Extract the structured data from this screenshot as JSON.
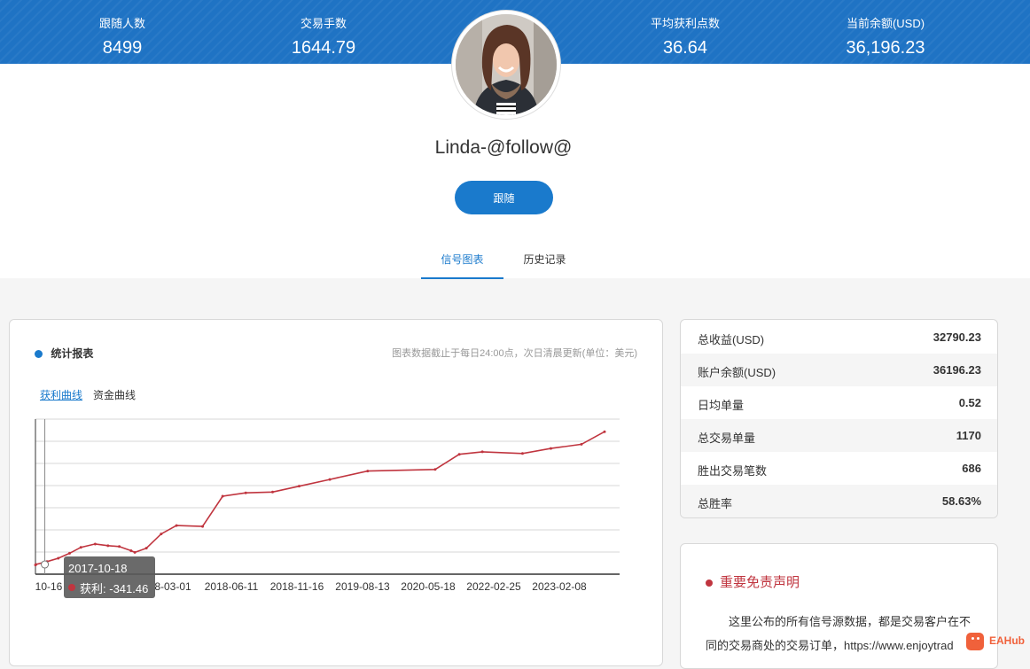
{
  "stats": {
    "followers": {
      "label": "跟随人数",
      "value": "8499"
    },
    "trades": {
      "label": "交易手数",
      "value": "1644.79"
    },
    "avg_points": {
      "label": "平均获利点数",
      "value": "36.64"
    },
    "balance": {
      "label": "当前余额(USD)",
      "value": "36,196.23"
    }
  },
  "profile": {
    "name": "Linda-@follow@",
    "follow_label": "跟随"
  },
  "tabs": [
    {
      "label": "信号图表"
    },
    {
      "label": "历史记录"
    }
  ],
  "chart_panel": {
    "title": "统计报表",
    "note": "图表数据截止于每日24:00点，次日清晨更新(单位：美元)",
    "subtabs": [
      {
        "label": "获利曲线"
      },
      {
        "label": "资金曲线"
      }
    ],
    "tooltip": {
      "date": "2017-10-18",
      "label": "获利:",
      "value": "-341.46"
    }
  },
  "chart_data": {
    "type": "line",
    "title": "",
    "xlabel": "",
    "ylabel": "",
    "x_tick_labels": [
      "10-16",
      "8-03-01",
      "2018-06-11",
      "2018-11-16",
      "2019-08-13",
      "2020-05-18",
      "2022-02-25",
      "2023-02-08"
    ],
    "series": [
      {
        "name": "获利",
        "color": "#c0353f",
        "x": [
          "2017-10-16",
          "2017-10-18",
          "2017-12-01",
          "2018-01-15",
          "2018-03-01",
          "2018-04-15",
          "2018-06-11",
          "2018-08-01",
          "2018-09-15",
          "2018-11-01",
          "2018-11-16",
          "2019-01-01",
          "2019-03-01",
          "2019-05-01",
          "2019-08-13",
          "2019-11-01",
          "2020-02-01",
          "2020-05-18",
          "2020-09-01",
          "2021-01-01",
          "2021-06-01",
          "2022-02-25",
          "2022-06-01",
          "2022-09-01",
          "2023-02-08",
          "2023-06-01",
          "2023-10-01",
          "2024-01-01"
        ],
        "values": [
          -400,
          -341.46,
          0,
          400,
          1000,
          1700,
          2100,
          1900,
          1800,
          1300,
          1100,
          1600,
          3300,
          4300,
          4200,
          7800,
          8200,
          8300,
          9000,
          9800,
          10800,
          11000,
          12800,
          13100,
          12900,
          13500,
          14000,
          15500
        ]
      }
    ]
  },
  "summary": [
    {
      "label": "总收益(USD)",
      "value": "32790.23"
    },
    {
      "label": "账户余额(USD)",
      "value": "36196.23"
    },
    {
      "label": "日均单量",
      "value": "0.52"
    },
    {
      "label": "总交易单量",
      "value": "1170"
    },
    {
      "label": "胜出交易笔数",
      "value": "686"
    },
    {
      "label": "总胜率",
      "value": "58.63%"
    }
  ],
  "disclaimer": {
    "title": "重要免责声明",
    "text": "这里公布的所有信号源数据，都是交易客户在不同的交易商处的交易订单，https://www.enjoytrad"
  },
  "watermark": "EAHub"
}
